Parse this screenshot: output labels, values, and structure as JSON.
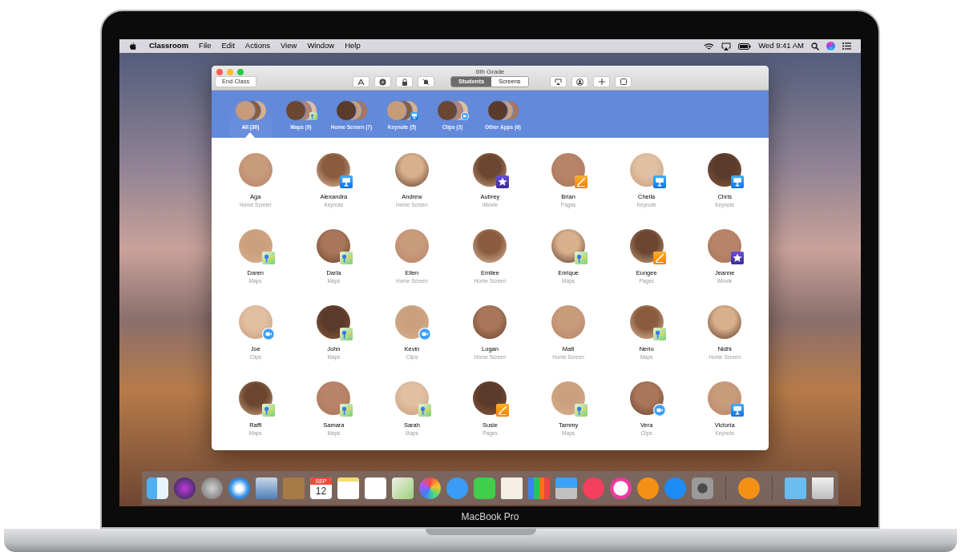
{
  "menu_bar": {
    "app": "Classroom",
    "menus": [
      "File",
      "Edit",
      "Actions",
      "View",
      "Window",
      "Help"
    ],
    "clock": "Wed 9:41 AM"
  },
  "window": {
    "title": "6th Grade",
    "end_button": "End Class",
    "segments": [
      {
        "label": "Students",
        "selected": true
      },
      {
        "label": "Screens",
        "selected": false
      }
    ]
  },
  "groups": [
    {
      "label": "All (30)",
      "selected": true,
      "kind": "plain"
    },
    {
      "label": "Maps (9)",
      "selected": false,
      "kind": "maps"
    },
    {
      "label": "Home Screen (7)",
      "selected": false,
      "kind": "plain"
    },
    {
      "label": "Keynote (5)",
      "selected": false,
      "kind": "keynote"
    },
    {
      "label": "Clips (3)",
      "selected": false,
      "kind": "clips"
    },
    {
      "label": "Other Apps (6)",
      "selected": false,
      "kind": "plain"
    }
  ],
  "students": [
    {
      "name": "Aga",
      "app": "Home Screen",
      "kind": "plain"
    },
    {
      "name": "Alexandra",
      "app": "Keynote",
      "kind": "keynote"
    },
    {
      "name": "Andrew",
      "app": "Home Screen",
      "kind": "plain"
    },
    {
      "name": "Aubrey",
      "app": "iMovie",
      "kind": "imovie"
    },
    {
      "name": "Brian",
      "app": "Pages",
      "kind": "pages"
    },
    {
      "name": "Chella",
      "app": "Keynote",
      "kind": "keynote"
    },
    {
      "name": "Chris",
      "app": "Keynote",
      "kind": "keynote"
    },
    {
      "name": "Daren",
      "app": "Maps",
      "kind": "maps"
    },
    {
      "name": "Darla",
      "app": "Maps",
      "kind": "maps"
    },
    {
      "name": "Ellen",
      "app": "Home Screen",
      "kind": "plain"
    },
    {
      "name": "Emilee",
      "app": "Home Screen",
      "kind": "plain"
    },
    {
      "name": "Enrique",
      "app": "Maps",
      "kind": "maps"
    },
    {
      "name": "Eungee",
      "app": "Pages",
      "kind": "pages"
    },
    {
      "name": "Jeanne",
      "app": "iMovie",
      "kind": "imovie"
    },
    {
      "name": "Joe",
      "app": "Clips",
      "kind": "clips"
    },
    {
      "name": "John",
      "app": "Maps",
      "kind": "maps"
    },
    {
      "name": "Kevin",
      "app": "Clips",
      "kind": "clips"
    },
    {
      "name": "Logan",
      "app": "Home Screen",
      "kind": "plain"
    },
    {
      "name": "Matt",
      "app": "Home Screen",
      "kind": "plain"
    },
    {
      "name": "Nerio",
      "app": "Maps",
      "kind": "maps"
    },
    {
      "name": "Nidhi",
      "app": "Home Screen",
      "kind": "plain"
    },
    {
      "name": "Raffi",
      "app": "Maps",
      "kind": "maps"
    },
    {
      "name": "Samara",
      "app": "Maps",
      "kind": "maps"
    },
    {
      "name": "Sarah",
      "app": "Maps",
      "kind": "maps"
    },
    {
      "name": "Susie",
      "app": "Pages",
      "kind": "pages"
    },
    {
      "name": "Tammy",
      "app": "Maps",
      "kind": "maps"
    },
    {
      "name": "Vera",
      "app": "Clips",
      "kind": "clips"
    },
    {
      "name": "Victoria",
      "app": "Keynote",
      "kind": "keynote"
    }
  ],
  "dock": {
    "calendar_month": "SEP",
    "calendar_day": "12"
  },
  "laptop_label": "MacBook Pro"
}
